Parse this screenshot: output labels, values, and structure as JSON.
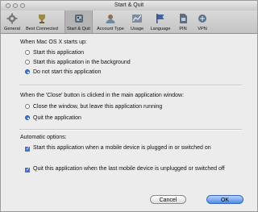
{
  "window": {
    "title": "Start & Quit"
  },
  "toolbar": {
    "items": [
      {
        "label": "General",
        "icon": "gear-icon"
      },
      {
        "label": "Best Connected",
        "icon": "trophy-icon"
      },
      {
        "label": "Start & Quit",
        "icon": "start-quit-icon",
        "selected": true
      },
      {
        "label": "Account Type",
        "icon": "account-icon"
      },
      {
        "label": "Usage",
        "icon": "usage-chart-icon"
      },
      {
        "label": "Language",
        "icon": "language-flag-icon"
      },
      {
        "label": "PIN",
        "icon": "pin-sim-icon"
      },
      {
        "label": "VPN",
        "icon": "vpn-network-icon"
      }
    ]
  },
  "startup": {
    "heading": "When Mac OS X starts up:",
    "options": [
      {
        "label": "Start this application",
        "selected": false
      },
      {
        "label": "Start this application in the background",
        "selected": false
      },
      {
        "label": "Do not start this application",
        "selected": true
      }
    ]
  },
  "close": {
    "heading": "When the 'Close' button is clicked in the main application window:",
    "options": [
      {
        "label": "Close the window, but leave this application running",
        "selected": false
      },
      {
        "label": "Quit the application",
        "selected": true
      }
    ]
  },
  "automatic": {
    "heading": "Automatic options:",
    "options": [
      {
        "label": "Start this application when a mobile device is plugged in or switched on",
        "checked": true
      },
      {
        "label": "Quit this application when the last mobile device is unplugged or switched off",
        "checked": true
      }
    ]
  },
  "buttons": {
    "cancel": "Cancel",
    "ok": "OK"
  },
  "colors": {
    "accent": "#3f74d8",
    "window_bg": "#ececec"
  }
}
